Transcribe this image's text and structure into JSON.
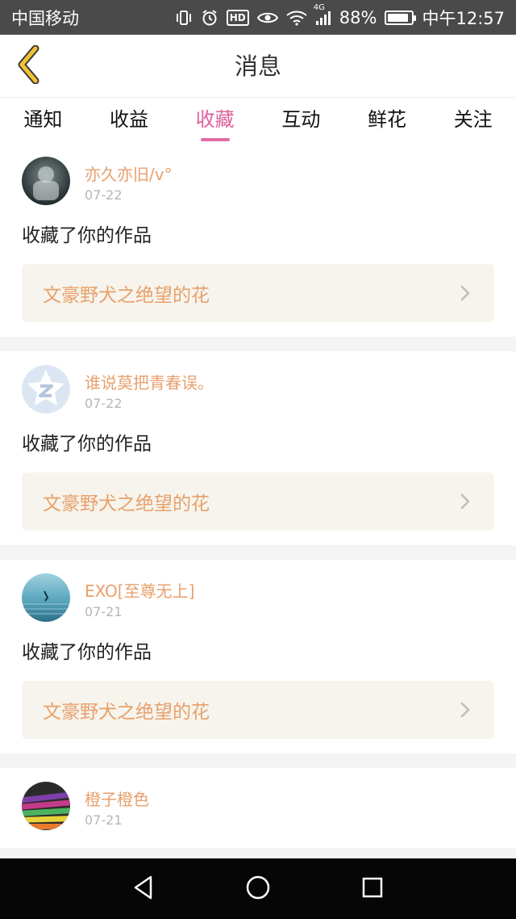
{
  "status_bar": {
    "carrier": "中国移动",
    "network": "4G",
    "battery": "88%",
    "battery_level": 0.88,
    "time": "中午12:57",
    "icons": [
      "vibrate-icon",
      "alarm-icon",
      "hd-icon",
      "eye-icon",
      "wifi-icon",
      "signal-icon",
      "battery-icon"
    ],
    "hd_label": "HD"
  },
  "header": {
    "title": "消息",
    "back_icon": "chevron-left-icon",
    "accent_color": "#f2c233"
  },
  "tabs": [
    {
      "label": "通知",
      "active": false
    },
    {
      "label": "收益",
      "active": false
    },
    {
      "label": "收藏",
      "active": true
    },
    {
      "label": "互动",
      "active": false
    },
    {
      "label": "鲜花",
      "active": false
    },
    {
      "label": "关注",
      "active": false
    }
  ],
  "colors": {
    "active_tab": "#e0609d",
    "username": "#e8a06c",
    "link_bg": "#f6f4ec"
  },
  "messages": [
    {
      "username": "亦久亦旧/v°",
      "date": "07-22",
      "action": "收藏了你的作品",
      "work": "文豪野犬之绝望的花"
    },
    {
      "username": "谁说莫把青春误。",
      "date": "07-22",
      "action": "收藏了你的作品",
      "work": "文豪野犬之绝望的花"
    },
    {
      "username": "EXO[至尊无上]",
      "date": "07-21",
      "action": "收藏了你的作品",
      "work": "文豪野犬之绝望的花"
    },
    {
      "username": "橙子橙色",
      "date": "07-21",
      "action": "",
      "work": ""
    }
  ],
  "nav_bar": {
    "buttons": [
      "back-triangle-icon",
      "home-circle-icon",
      "recents-square-icon"
    ]
  }
}
